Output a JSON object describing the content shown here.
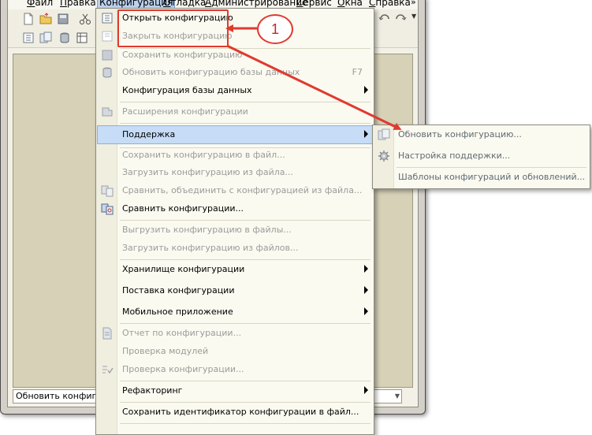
{
  "menubar": {
    "items": [
      {
        "label": "Файл",
        "active": false
      },
      {
        "label": "Правка",
        "active": false
      },
      {
        "label": "Конфигурация",
        "active": true
      },
      {
        "label": "Отладка",
        "active": false
      },
      {
        "label": "Администрирование",
        "active": false
      },
      {
        "label": "Сервис",
        "active": false
      },
      {
        "label": "Окна",
        "active": false
      },
      {
        "label": "Справка",
        "active": false
      }
    ]
  },
  "status": {
    "text": "Обновить конфигура"
  },
  "config_menu": {
    "items": [
      {
        "label": "Открыть конфигурацию",
        "disabled": false
      },
      {
        "label": "Закрыть конфигурацию",
        "disabled": true
      },
      {
        "label": "Сохранить конфигурацию",
        "disabled": true
      },
      {
        "label": "Обновить конфигурацию базы данных",
        "disabled": true,
        "shortcut": "F7"
      },
      {
        "label": "Конфигурация базы данных",
        "disabled": false,
        "submenu": true
      },
      {
        "label": "Расширения конфигурации",
        "disabled": true
      },
      {
        "label": "Поддержка",
        "disabled": false,
        "submenu": true,
        "highlighted": true
      },
      {
        "label": "Сохранить конфигурацию в файл...",
        "disabled": true
      },
      {
        "label": "Загрузить конфигурацию из файла...",
        "disabled": true
      },
      {
        "label": "Сравнить, объединить с конфигурацией из файла...",
        "disabled": true
      },
      {
        "label": "Сравнить конфигурации...",
        "disabled": false
      },
      {
        "label": "Выгрузить конфигурацию в файлы...",
        "disabled": true
      },
      {
        "label": "Загрузить конфигурацию из файлов...",
        "disabled": true
      },
      {
        "label": "Хранилище конфигурации",
        "disabled": false,
        "submenu": true
      },
      {
        "label": "Поставка конфигурации",
        "disabled": false,
        "submenu": true
      },
      {
        "label": "Мобильное приложение",
        "disabled": false,
        "submenu": true
      },
      {
        "label": "Отчет по конфигурации...",
        "disabled": true
      },
      {
        "label": "Проверка модулей",
        "disabled": true
      },
      {
        "label": "Проверка конфигурации...",
        "disabled": true
      },
      {
        "label": "Рефакторинг",
        "disabled": false,
        "submenu": true
      },
      {
        "label": "Сохранить идентификатор конфигурации в файл...",
        "disabled": false
      }
    ]
  },
  "support_submenu": {
    "items": [
      {
        "label": "Обновить конфигурацию..."
      },
      {
        "label": "Настройка поддержки..."
      },
      {
        "label": "Шаблоны конфигураций и обновлений..."
      }
    ]
  },
  "callout": {
    "number": "1",
    "color": "#e03a2f"
  },
  "icons": [
    "new-document-icon",
    "open-folder-icon",
    "save-icon",
    "cut-icon",
    "undo-icon",
    "redo-icon",
    "database-icon",
    "tree-icon",
    "compare-icon",
    "report-icon",
    "gear-icon"
  ]
}
